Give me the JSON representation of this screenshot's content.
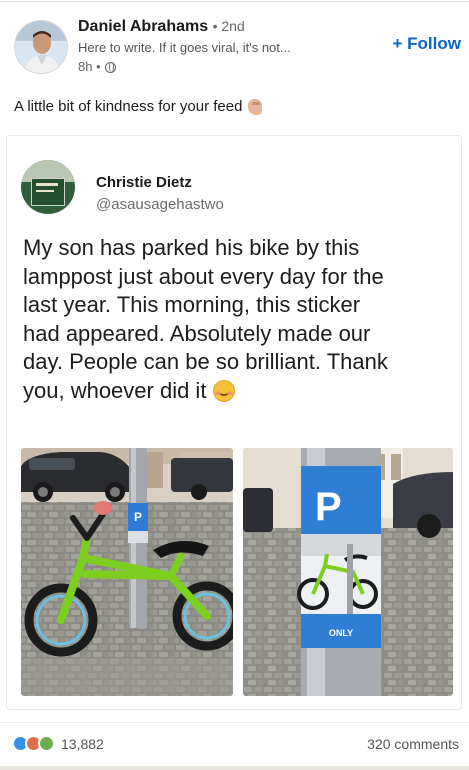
{
  "post": {
    "author_name": "Daniel Abrahams",
    "degree": "• 2nd",
    "headline": "Here to write. If it goes viral, it's not...",
    "time": "8h •",
    "follow_label": "+ Follow",
    "text": "A little bit of kindness for your feed"
  },
  "shared": {
    "name": "Christie Dietz",
    "handle": "@asausagehastwo",
    "lines": [
      "My son has parked his bike by this",
      "lamppost just about every day for the",
      "last year. This morning, this sticker",
      "had appeared. Absolutely made our",
      "day. People can be so brilliant. Thank",
      "you, whoever did it"
    ],
    "photo_sign_letter": "P",
    "photo_sign_text": "ONLY"
  },
  "footer": {
    "reaction_count": "13,882",
    "comments": "320 comments"
  },
  "colors": {
    "link_blue": "#0a66c2",
    "bike_green": "#7ccf1e"
  },
  "icons": [
    "globe-icon",
    "hand-icon",
    "smile-icon",
    "like-reaction-icon",
    "love-reaction-icon",
    "support-reaction-icon"
  ]
}
